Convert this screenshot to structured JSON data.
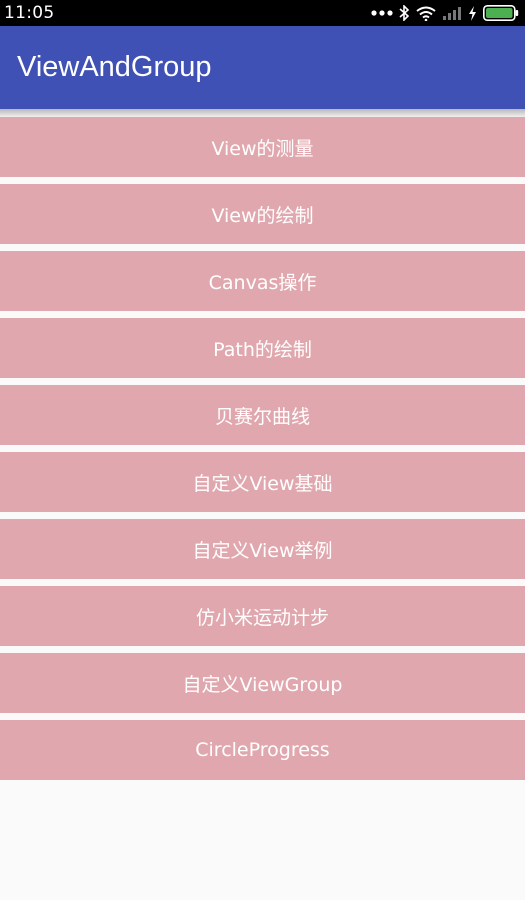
{
  "status_bar": {
    "time": "11:05",
    "icons": [
      "more-dots-icon",
      "bluetooth-icon",
      "wifi-icon",
      "signal-icon",
      "charging-icon",
      "battery-icon"
    ],
    "battery_color": "#4caf50"
  },
  "app_bar": {
    "title": "ViewAndGroup",
    "color": "#3f51b5"
  },
  "menu": {
    "item_color": "#e0a8ae",
    "items": [
      {
        "label": "View的测量"
      },
      {
        "label": "View的绘制"
      },
      {
        "label": "Canvas操作"
      },
      {
        "label": "Path的绘制"
      },
      {
        "label": "贝赛尔曲线"
      },
      {
        "label": "自定义View基础"
      },
      {
        "label": "自定义View举例"
      },
      {
        "label": "仿小米运动计步"
      },
      {
        "label": "自定义ViewGroup"
      },
      {
        "label": "CircleProgress"
      }
    ]
  }
}
